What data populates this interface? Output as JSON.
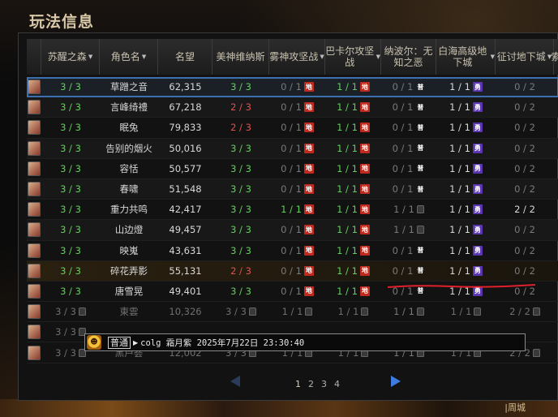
{
  "window": {
    "title": "玩法信息"
  },
  "columns": [
    {
      "label": "苏醒之森",
      "sort": true
    },
    {
      "label": "角色名",
      "sort": true
    },
    {
      "label": "名望",
      "sort": false
    },
    {
      "label": "美神维纳斯",
      "sort": false
    },
    {
      "label": "雾神攻坚战",
      "sort": true
    },
    {
      "label": "巴卡尔攻坚战",
      "sort": true
    },
    {
      "label": "纳波尔：无知之恶",
      "sort": false
    },
    {
      "label": "白海高级地下城",
      "sort": true
    },
    {
      "label": "征讨地下城",
      "sort": true
    },
    {
      "label": "索",
      "sort": false
    }
  ],
  "badges": {
    "hell": "地",
    "normal": "普",
    "hero": "勇"
  },
  "rows": [
    {
      "c0": "3 / 3",
      "name": "草蹭之音",
      "fame": "62,315",
      "venus": "3 / 3",
      "fog": "0 / 1",
      "bakal": "1 / 1",
      "nabol": "0 / 1",
      "whitesea": "1 / 1",
      "crusade": "0 / 2",
      "state": "sel"
    },
    {
      "c0": "3 / 3",
      "name": "言峰绮禮",
      "fame": "67,218",
      "venus": "2 / 3",
      "fog": "0 / 1",
      "bakal": "1 / 1",
      "nabol": "0 / 1",
      "whitesea": "1 / 1",
      "crusade": "0 / 2",
      "state": "alt"
    },
    {
      "c0": "3 / 3",
      "name": "眠兔",
      "fame": "79,833",
      "venus": "2 / 3",
      "fog": "0 / 1",
      "bakal": "1 / 1",
      "nabol": "0 / 1",
      "whitesea": "1 / 1",
      "crusade": "0 / 2",
      "state": ""
    },
    {
      "c0": "3 / 3",
      "name": "告别的烟火",
      "fame": "50,016",
      "venus": "3 / 3",
      "fog": "0 / 1",
      "bakal": "1 / 1",
      "nabol": "0 / 1",
      "whitesea": "1 / 1",
      "crusade": "0 / 2",
      "state": "alt"
    },
    {
      "c0": "3 / 3",
      "name": "容恬",
      "fame": "50,577",
      "venus": "3 / 3",
      "fog": "0 / 1",
      "bakal": "1 / 1",
      "nabol": "0 / 1",
      "whitesea": "1 / 1",
      "crusade": "0 / 2",
      "state": ""
    },
    {
      "c0": "3 / 3",
      "name": "春啸",
      "fame": "51,548",
      "venus": "3 / 3",
      "fog": "0 / 1",
      "bakal": "1 / 1",
      "nabol": "0 / 1",
      "whitesea": "1 / 1",
      "crusade": "0 / 2",
      "state": "alt"
    },
    {
      "c0": "3 / 3",
      "name": "重力共鸣",
      "fame": "42,417",
      "venus": "3 / 3",
      "fog": "1 / 1",
      "bakal": "1 / 1",
      "nabol": "1 / 1",
      "whitesea": "1 / 1",
      "crusade": "2 / 2",
      "state": ""
    },
    {
      "c0": "3 / 3",
      "name": "山边燈",
      "fame": "49,457",
      "venus": "3 / 3",
      "fog": "0 / 1",
      "bakal": "1 / 1",
      "nabol": "1 / 1",
      "whitesea": "1 / 1",
      "crusade": "0 / 2",
      "state": "alt"
    },
    {
      "c0": "3 / 3",
      "name": "映嵬",
      "fame": "43,631",
      "venus": "3 / 3",
      "fog": "0 / 1",
      "bakal": "1 / 1",
      "nabol": "0 / 1",
      "whitesea": "1 / 1",
      "crusade": "0 / 2",
      "state": ""
    },
    {
      "c0": "3 / 3",
      "name": "碎花弄影",
      "fame": "55,131",
      "venus": "2 / 3",
      "fog": "0 / 1",
      "bakal": "1 / 1",
      "nabol": "0 / 1",
      "whitesea": "1 / 1",
      "crusade": "0 / 2",
      "state": "gold"
    },
    {
      "c0": "3 / 3",
      "name": "唐雪晃",
      "fame": "49,401",
      "venus": "3 / 3",
      "fog": "0 / 1",
      "bakal": "1 / 1",
      "nabol": "0 / 1",
      "whitesea": "1 / 1",
      "crusade": "0 / 2",
      "state": ""
    },
    {
      "c0": "3 / 3",
      "name": "東雲",
      "fame": "10,326",
      "venus": "3 / 3",
      "fog": "1 / 1",
      "bakal": "1 / 1",
      "nabol": "1 / 1",
      "whitesea": "1 / 1",
      "crusade": "2 / 2",
      "state": "dim"
    },
    {
      "c0": "3 / 3",
      "name": "",
      "fame": "",
      "venus": "",
      "fog": "",
      "bakal": "",
      "nabol": "",
      "whitesea": "",
      "crusade": "",
      "state": "dim"
    },
    {
      "c0": "3 / 3",
      "name": "黑芦荟",
      "fame": "12,002",
      "venus": "3 / 3",
      "fog": "1 / 1",
      "bakal": "1 / 1",
      "nabol": "1 / 1",
      "whitesea": "1 / 1",
      "crusade": "2 / 2",
      "state": "dim"
    }
  ],
  "chat": {
    "channel": "普通",
    "text": "colg  霜月紫  2025年7月22日 23:30:40"
  },
  "pager": {
    "pages": [
      "1",
      "2",
      "3",
      "4"
    ],
    "current": "1"
  },
  "bottom_label": "|周城"
}
